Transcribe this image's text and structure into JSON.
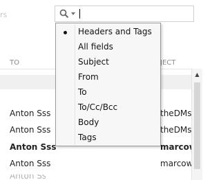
{
  "header": {
    "top_left_fragment": "rs",
    "search_value": ""
  },
  "columns": {
    "to": "TO",
    "subject": "JECT"
  },
  "rows": [
    {
      "sender": "Anton Sss",
      "subject": "theDMs",
      "bold": false
    },
    {
      "sender": "Anton Sss",
      "subject": "theDMs",
      "bold": false
    },
    {
      "sender": "Anton Sss",
      "subject": "marcow",
      "bold": true
    },
    {
      "sender": "Anton Sss",
      "subject": "marcow",
      "bold": false
    }
  ],
  "search_menu": {
    "selected": "Headers and Tags",
    "items": [
      "Headers and Tags",
      "All fields",
      "Subject",
      "From",
      "To",
      "To/Cc/Bcc",
      "Body",
      "Tags"
    ]
  },
  "icons": {
    "search": "magnifier-icon",
    "dropdown": "chevron-down-icon",
    "scroll_up": "arrow-up-icon",
    "bullet": "bullet-icon"
  }
}
